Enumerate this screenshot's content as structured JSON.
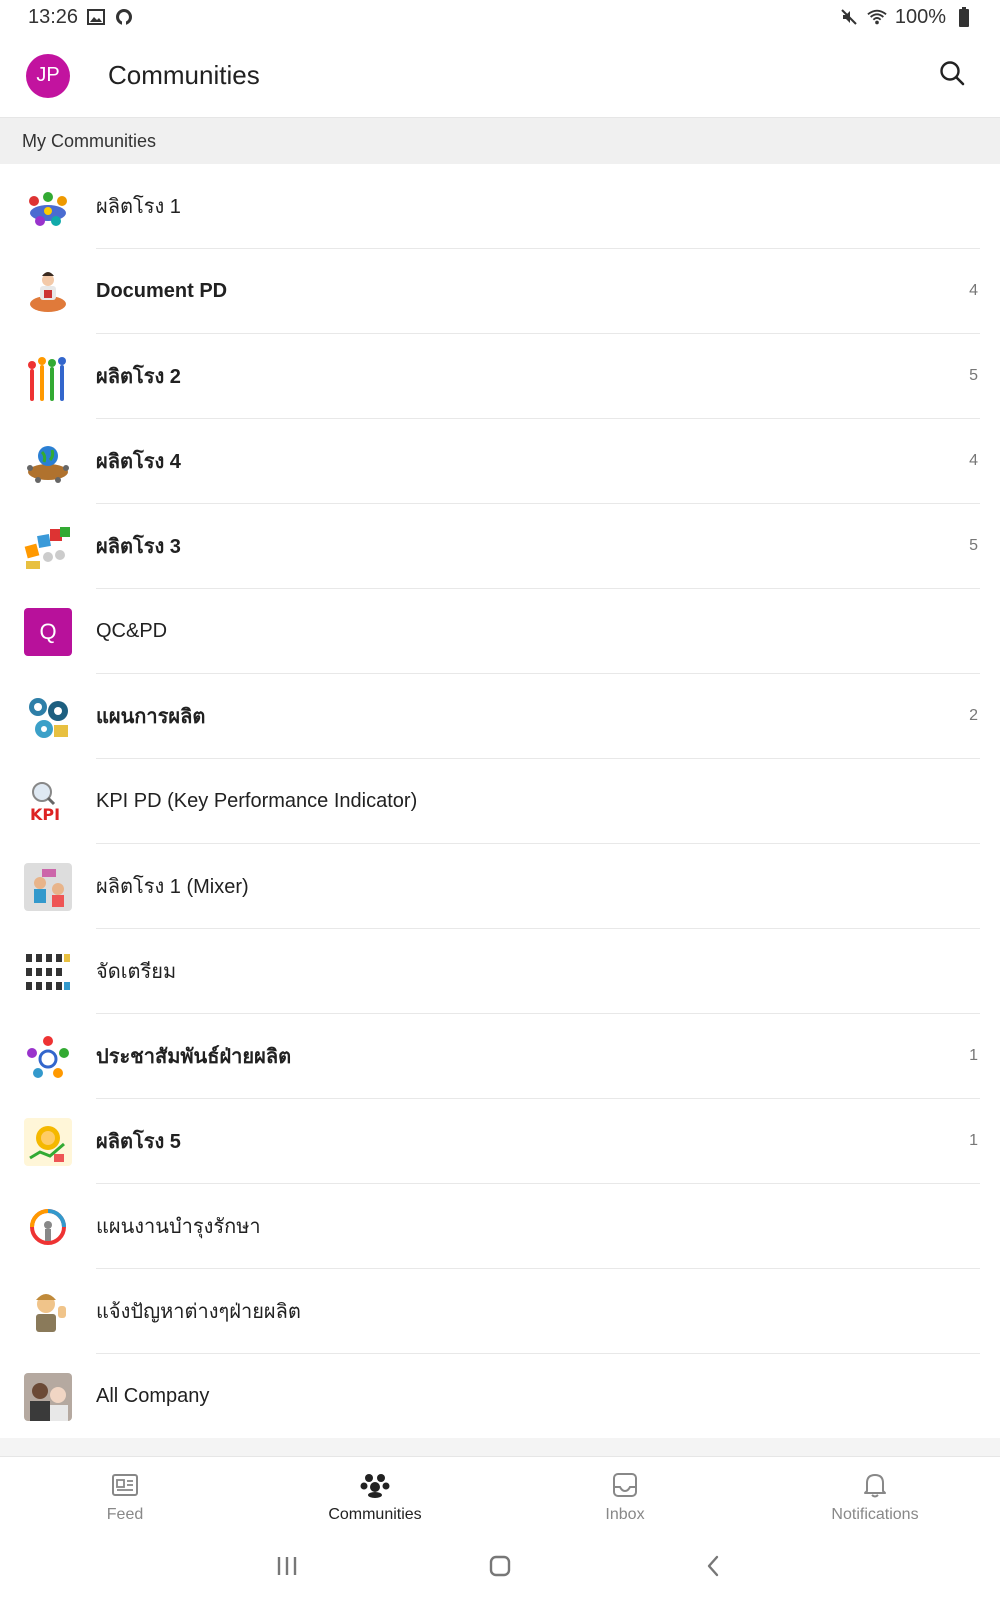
{
  "status_bar": {
    "time": "13:26",
    "battery": "100%"
  },
  "header": {
    "avatar_initials": "JP",
    "title": "Communities"
  },
  "section": {
    "title": "My Communities"
  },
  "communities": [
    {
      "name": "ผลิตโรง 1",
      "count": "",
      "bold": false,
      "icon": "group-meeting-icon"
    },
    {
      "name": "Document PD",
      "count": "4",
      "bold": true,
      "icon": "document-worker-icon"
    },
    {
      "name": "ผลิตโรง 2",
      "count": "5",
      "bold": true,
      "icon": "people-hands-up-icon"
    },
    {
      "name": "ผลิตโรง 4",
      "count": "4",
      "bold": true,
      "icon": "globe-meeting-icon"
    },
    {
      "name": "ผลิตโรง 3",
      "count": "5",
      "bold": true,
      "icon": "team-letters-icon"
    },
    {
      "name": "QC&PD",
      "count": "",
      "bold": false,
      "icon": "letter-q-icon",
      "letter": "Q"
    },
    {
      "name": "แผนการผลิต",
      "count": "2",
      "bold": true,
      "icon": "gears-team-icon"
    },
    {
      "name": "KPI PD (Key Performance Indicator)",
      "count": "",
      "bold": false,
      "icon": "kpi-magnifier-icon"
    },
    {
      "name": "ผลิตโรง 1 (Mixer)",
      "count": "",
      "bold": false,
      "icon": "kids-photo-icon"
    },
    {
      "name": "จัดเตรียม",
      "count": "",
      "bold": false,
      "icon": "workers-grid-icon"
    },
    {
      "name": "ประชาสัมพันธ์ฝ่ายผลิต",
      "count": "1",
      "bold": true,
      "icon": "people-circle-icon"
    },
    {
      "name": "ผลิตโรง 5",
      "count": "1",
      "bold": true,
      "icon": "sun-chart-icon"
    },
    {
      "name": "แผนงานบำรุงรักษา",
      "count": "",
      "bold": false,
      "icon": "target-person-icon"
    },
    {
      "name": "แจ้งปัญหาต่างๆฝ่ายผลิต",
      "count": "",
      "bold": false,
      "icon": "worker-thumbs-up-icon"
    },
    {
      "name": "All Company",
      "count": "",
      "bold": false,
      "icon": "family-photo-icon"
    }
  ],
  "bottom_nav": {
    "feed": "Feed",
    "communities": "Communities",
    "inbox": "Inbox",
    "notifications": "Notifications"
  },
  "colors": {
    "avatar_bg": "#c2139f",
    "letter_tile_bg": "#b8119b",
    "section_bg": "#f0f0f0"
  }
}
